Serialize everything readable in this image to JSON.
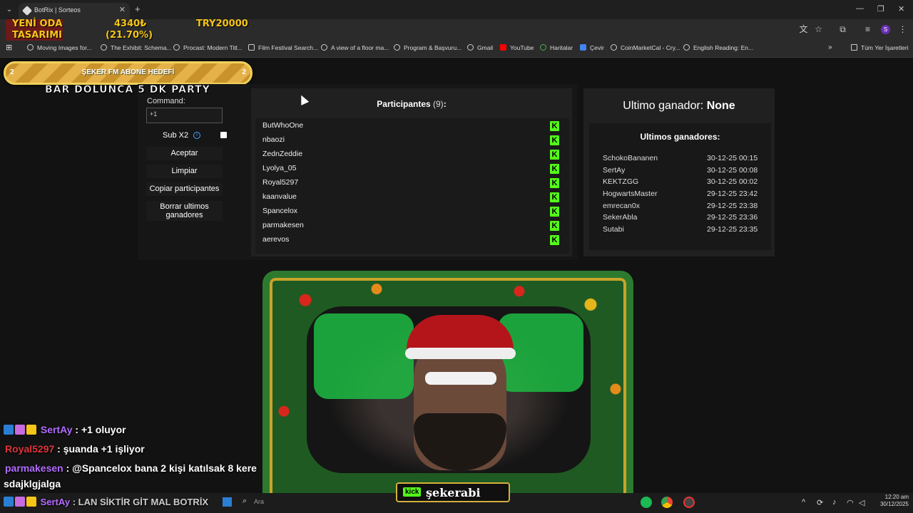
{
  "browser": {
    "tab_title": "BotRix | Sorteos",
    "bookmarks": [
      "Moving Images for...",
      "The Exhibit: Schema...",
      "Procast: Modern Titl...",
      "Film Festival Search...",
      "A view of a floor ma...",
      "Program & Başvuru...",
      "Gmail",
      "YouTube",
      "Haritalar",
      "Çevir",
      "CoinMarketCal - Cry...",
      "English Reading: En..."
    ],
    "all_bookmarks": "Tüm Yer İşaretleri",
    "profile_initial": "S"
  },
  "overlay": {
    "ticker_label_line1": "YENİ ODA",
    "ticker_label_line2": "TASARIMI",
    "ticker_amount": "4340₺",
    "ticker_percent": "(21.70%)",
    "ticker_goal": "TRY20000",
    "sub_goal_label": "ŞEKER FM ABONE HEDEFİ",
    "sub_goal_left": "2",
    "sub_goal_right": "2",
    "sub_goal_progress": 1.0,
    "party_text": "BAR DOLUNCA 5 DK PARTY",
    "kick_label": "kick",
    "kick_channel": "şekerabi"
  },
  "raffle": {
    "command_label": "Command:",
    "command_value": "+1",
    "sub_x2_label": "Sub X2",
    "buttons": {
      "accept": "Aceptar",
      "clear": "Limpiar",
      "copy": "Copiar participantes",
      "delete_line1": "Borrar ultimos",
      "delete_line2": "ganadores"
    },
    "participants_title": "Participantes",
    "participants_count": "(9)",
    "participants_colon": ":",
    "participants": [
      "ButWhoOne",
      "nbaozi",
      "ZednZeddie",
      "Lyolya_05",
      "Royal5297",
      "kaanvalue",
      "Spancelox",
      "parmakesen",
      "aerevos"
    ],
    "platform_icon": "K",
    "last_winner_label": "Ultimo ganador:",
    "last_winner_value": "None",
    "winners_title": "Ultimos ganadores:",
    "winners": [
      {
        "name": "SchokoBananen",
        "date": "30-12-25 00:15"
      },
      {
        "name": "SertAy",
        "date": "30-12-25 00:08"
      },
      {
        "name": "KEKTZGG",
        "date": "30-12-25 00:02"
      },
      {
        "name": "HogwartsMaster",
        "date": "29-12-25 23:42"
      },
      {
        "name": "emrecan0x",
        "date": "29-12-25 23:38"
      },
      {
        "name": "SekerAbla",
        "date": "29-12-25 23:36"
      },
      {
        "name": "Sutabi",
        "date": "29-12-25 23:35"
      }
    ]
  },
  "chat": [
    {
      "user": "SertAy",
      "color": "#b36bff",
      "text": ": +1 oluyor"
    },
    {
      "user": "Royal5297",
      "color": "#e0343b",
      "text": ": şuanda +1 işliyor"
    },
    {
      "user": "parmakesen",
      "color": "#b36bff",
      "text": ": @Spancelox bana 2 kişi katılsak 8 kere"
    },
    {
      "user": "",
      "color": "#ffffff",
      "text": "sdajklgjalga"
    },
    {
      "user": "SertAy",
      "color": "#b36bff",
      "text": ": LAN SİKTİR GİT MAL BOTRİX"
    }
  ],
  "taskbar": {
    "search_placeholder": "Ara",
    "time": "12:20 am",
    "date": "30/12/2025"
  },
  "colors": {
    "kick_green": "#53fc18",
    "gold": "#f5c518",
    "panel": "#202020"
  }
}
